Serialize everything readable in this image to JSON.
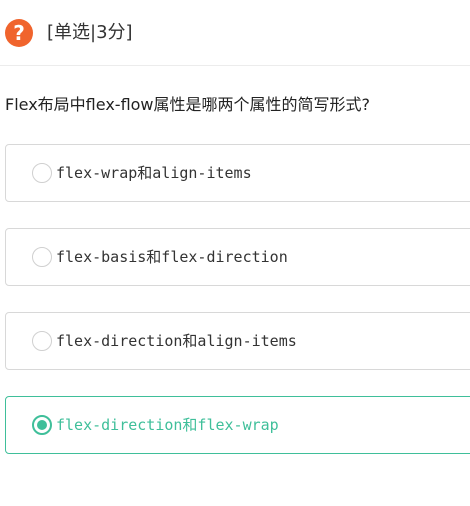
{
  "header": {
    "icon": "question-icon",
    "icon_glyph": "?",
    "question_type": "[单选|3分]"
  },
  "question": {
    "text": "Flex布局中flex-flow属性是哪两个属性的简写形式?"
  },
  "options": [
    {
      "label": "flex-wrap和align-items",
      "selected": false
    },
    {
      "label": "flex-basis和flex-direction",
      "selected": false
    },
    {
      "label": "flex-direction和align-items",
      "selected": false
    },
    {
      "label": "flex-direction和flex-wrap",
      "selected": true
    }
  ],
  "colors": {
    "icon_bg": "#f0642d",
    "selected_accent": "#3fbf9a",
    "option_border": "#d8d8d8"
  }
}
